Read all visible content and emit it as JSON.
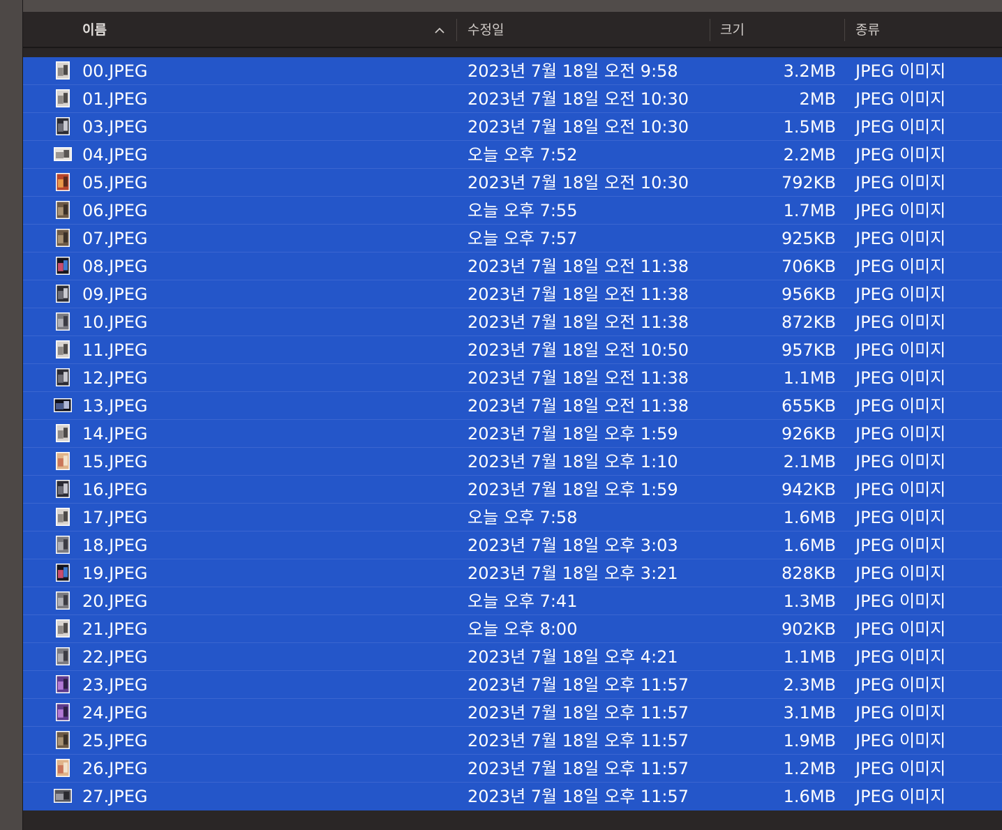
{
  "header": {
    "name_label": "이름",
    "date_label": "수정일",
    "size_label": "크기",
    "kind_label": "종류",
    "sort_icon": "chevron-up-icon"
  },
  "colors": {
    "selection": "#2456c9",
    "background": "#2a2626",
    "text": "#ffffff"
  },
  "files": [
    {
      "name": "00.JPEG",
      "date": "2023년 7월 18일 오전 9:58",
      "size": "3.2MB",
      "kind": "JPEG 이미지",
      "thumb": "portrait-light"
    },
    {
      "name": "01.JPEG",
      "date": "2023년 7월 18일 오전 10:30",
      "size": "2MB",
      "kind": "JPEG 이미지",
      "thumb": "portrait-light"
    },
    {
      "name": "03.JPEG",
      "date": "2023년 7월 18일 오전 10:30",
      "size": "1.5MB",
      "kind": "JPEG 이미지",
      "thumb": "portrait-dark"
    },
    {
      "name": "04.JPEG",
      "date": "오늘 오후 7:52",
      "size": "2.2MB",
      "kind": "JPEG 이미지",
      "thumb": "landscape-light"
    },
    {
      "name": "05.JPEG",
      "date": "2023년 7월 18일 오전 10:30",
      "size": "792KB",
      "kind": "JPEG 이미지",
      "thumb": "portrait-red"
    },
    {
      "name": "06.JPEG",
      "date": "오늘 오후 7:55",
      "size": "1.7MB",
      "kind": "JPEG 이미지",
      "thumb": "portrait-brown"
    },
    {
      "name": "07.JPEG",
      "date": "오늘 오후 7:57",
      "size": "925KB",
      "kind": "JPEG 이미지",
      "thumb": "portrait-brown"
    },
    {
      "name": "08.JPEG",
      "date": "2023년 7월 18일 오전 11:38",
      "size": "706KB",
      "kind": "JPEG 이미지",
      "thumb": "portrait-night"
    },
    {
      "name": "09.JPEG",
      "date": "2023년 7월 18일 오전 11:38",
      "size": "956KB",
      "kind": "JPEG 이미지",
      "thumb": "portrait-dark"
    },
    {
      "name": "10.JPEG",
      "date": "2023년 7월 18일 오전 11:38",
      "size": "872KB",
      "kind": "JPEG 이미지",
      "thumb": "portrait-gray"
    },
    {
      "name": "11.JPEG",
      "date": "2023년 7월 18일 오전 10:50",
      "size": "957KB",
      "kind": "JPEG 이미지",
      "thumb": "portrait-light"
    },
    {
      "name": "12.JPEG",
      "date": "2023년 7월 18일 오전 11:38",
      "size": "1.1MB",
      "kind": "JPEG 이미지",
      "thumb": "portrait-dark"
    },
    {
      "name": "13.JPEG",
      "date": "2023년 7월 18일 오전 11:38",
      "size": "655KB",
      "kind": "JPEG 이미지",
      "thumb": "landscape-night"
    },
    {
      "name": "14.JPEG",
      "date": "2023년 7월 18일 오후 1:59",
      "size": "926KB",
      "kind": "JPEG 이미지",
      "thumb": "portrait-light"
    },
    {
      "name": "15.JPEG",
      "date": "2023년 7월 18일 오후 1:10",
      "size": "2.1MB",
      "kind": "JPEG 이미지",
      "thumb": "portrait-warm"
    },
    {
      "name": "16.JPEG",
      "date": "2023년 7월 18일 오후 1:59",
      "size": "942KB",
      "kind": "JPEG 이미지",
      "thumb": "portrait-dark"
    },
    {
      "name": "17.JPEG",
      "date": "오늘 오후 7:58",
      "size": "1.6MB",
      "kind": "JPEG 이미지",
      "thumb": "portrait-light"
    },
    {
      "name": "18.JPEG",
      "date": "2023년 7월 18일 오후 3:03",
      "size": "1.6MB",
      "kind": "JPEG 이미지",
      "thumb": "portrait-gray"
    },
    {
      "name": "19.JPEG",
      "date": "2023년 7월 18일 오후 3:21",
      "size": "828KB",
      "kind": "JPEG 이미지",
      "thumb": "portrait-night"
    },
    {
      "name": "20.JPEG",
      "date": "오늘 오후 7:41",
      "size": "1.3MB",
      "kind": "JPEG 이미지",
      "thumb": "portrait-gray"
    },
    {
      "name": "21.JPEG",
      "date": "오늘 오후 8:00",
      "size": "902KB",
      "kind": "JPEG 이미지",
      "thumb": "portrait-light"
    },
    {
      "name": "22.JPEG",
      "date": "2023년 7월 18일 오후 4:21",
      "size": "1.1MB",
      "kind": "JPEG 이미지",
      "thumb": "portrait-gray"
    },
    {
      "name": "23.JPEG",
      "date": "2023년 7월 18일 오후 11:57",
      "size": "2.3MB",
      "kind": "JPEG 이미지",
      "thumb": "portrait-purple"
    },
    {
      "name": "24.JPEG",
      "date": "2023년 7월 18일 오후 11:57",
      "size": "3.1MB",
      "kind": "JPEG 이미지",
      "thumb": "portrait-purple"
    },
    {
      "name": "25.JPEG",
      "date": "2023년 7월 18일 오후 11:57",
      "size": "1.9MB",
      "kind": "JPEG 이미지",
      "thumb": "portrait-brown"
    },
    {
      "name": "26.JPEG",
      "date": "2023년 7월 18일 오후 11:57",
      "size": "1.2MB",
      "kind": "JPEG 이미지",
      "thumb": "portrait-warm"
    },
    {
      "name": "27.JPEG",
      "date": "2023년 7월 18일 오후 11:57",
      "size": "1.6MB",
      "kind": "JPEG 이미지",
      "thumb": "landscape-gray"
    }
  ]
}
